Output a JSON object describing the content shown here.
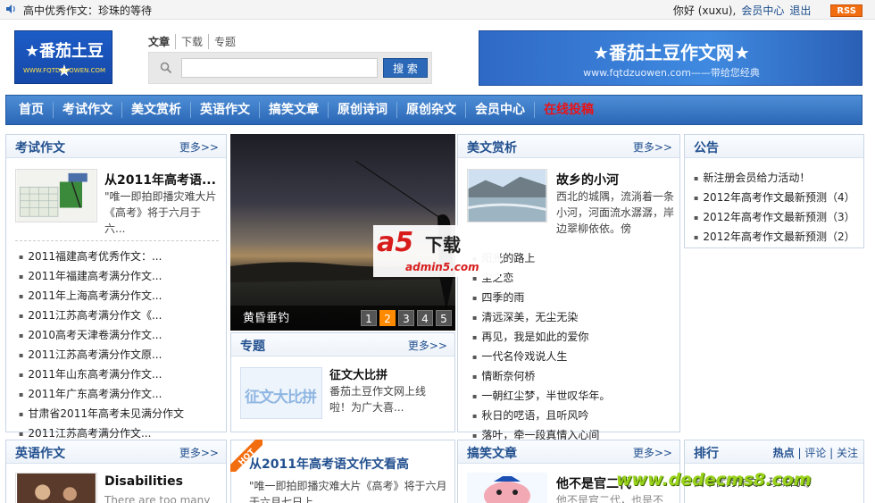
{
  "topbar": {
    "notice": "高中优秀作文：珍珠的等待",
    "greeting": "你好 (xuxu),",
    "member_center": "会员中心",
    "logout": "退出",
    "rss": "RSS"
  },
  "logo": {
    "title": "★番茄土豆★",
    "url": "WWW.FQTDZUOWEN.COM"
  },
  "search": {
    "tabs": [
      "文章",
      "下载",
      "专题"
    ],
    "placeholder": "",
    "button": "搜 索"
  },
  "banner": {
    "title": "★番茄土豆作文网★",
    "sub": "www.fqtdzuowen.com——带给您经典"
  },
  "nav": {
    "items": [
      "首页",
      "考试作文",
      "美文赏析",
      "英语作文",
      "搞笑文章",
      "原创诗词",
      "原创杂文",
      "会员中心"
    ],
    "highlight": "在线投稿"
  },
  "more_label": "更多>>",
  "exam": {
    "title": "考试作文",
    "feature_title": "从2011年高考语...",
    "feature_desc": "\"唯一即拍即播灾难大片《高考》将于六月于六...",
    "list": [
      "2011福建高考优秀作文：...",
      "2011年福建高考满分作文...",
      "2011年上海高考满分作文...",
      "2011江苏高考满分作文《...",
      "2010高考天津卷满分作文...",
      "2011江苏高考满分作文原...",
      "2011年山东高考满分作文...",
      "2011年广东高考满分作文...",
      "甘肃省2011年高考未见满分作文",
      "2011江苏高考满分作文..."
    ]
  },
  "slider": {
    "caption": "黄昏垂钓",
    "pages": [
      "1",
      "2",
      "3",
      "4",
      "5"
    ],
    "active": "2"
  },
  "topic": {
    "title": "专题",
    "feature_title": "征文大比拼",
    "feature_desc": "番茄土豆作文网上线啦！为广大喜...",
    "thumb_text": "征文大比拼"
  },
  "essays": {
    "title": "美文赏析",
    "feature_title": "故乡的小河",
    "feature_desc": "西北的城隅，流淌着一条小河，河面流水潺潺，岸边翠柳依依。傍",
    "list": [
      "阳光的路上",
      "尘之恋",
      "四季的雨",
      "清远深美，无尘无染",
      "再见，我是如此的爱你",
      "一代名伶戏说人生",
      "情断奈何桥",
      "一朝红尘梦，半世叹华年。",
      "秋日的呓语，且听风吟",
      "落叶，牵一段真情入心间"
    ]
  },
  "notice": {
    "title": "公告",
    "list": [
      "新注册会员给力活动！",
      "2012年高考作文最新预测（4）",
      "2012年高考作文最新预测（3）",
      "2012年高考作文最新预测（2）"
    ]
  },
  "english": {
    "title": "英语作文",
    "feature_title": "Disabilities",
    "feature_desc": "There are too many"
  },
  "hot": {
    "badge": "HOT",
    "title": "从2011年高考语文作文看高",
    "desc": "\"唯一即拍即播灾难大片《高考》将于六月于六月七日上"
  },
  "funny": {
    "title": "搞笑文章",
    "feature_title": "他不是官二代",
    "feature_desc": "他不是官二代，也是不"
  },
  "rank": {
    "title": "排行",
    "tabs": [
      "热点",
      "评论",
      "关注"
    ],
    "first": "高中优秀作文：珍珠的等"
  },
  "watermarks": {
    "a5_big": "a5",
    "a5_dl": "下载",
    "a5_domain": "admin5.com",
    "dede": "www.dedecms8.com"
  }
}
